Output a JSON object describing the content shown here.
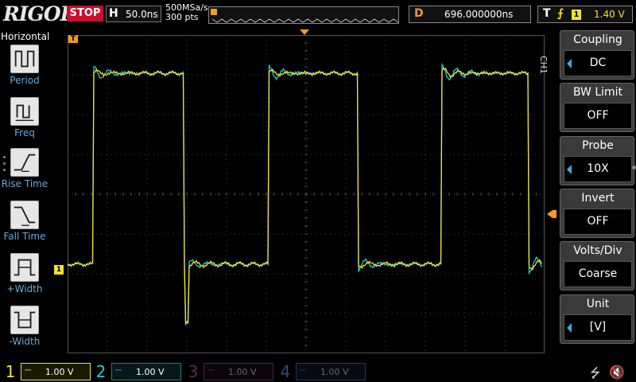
{
  "top": {
    "brand": "RIGOL",
    "run_state": "STOP",
    "timebase_label": "H",
    "timebase_value": "50.0ns",
    "sample_rate": "500MSa/s",
    "memory_depth": "300 pts",
    "delay_label": "D",
    "delay_value": "696.000000ns",
    "trigger_label": "T",
    "trigger_source": "1",
    "trigger_level": "1.40 V"
  },
  "left_menu": {
    "title": "Horizontal",
    "items": [
      {
        "label": "Period",
        "icon": "period-icon"
      },
      {
        "label": "Freq",
        "icon": "freq-icon"
      },
      {
        "label": "Rise Time",
        "icon": "rise-time-icon"
      },
      {
        "label": "Fall Time",
        "icon": "fall-time-icon"
      },
      {
        "label": "+Width",
        "icon": "pos-width-icon"
      },
      {
        "label": "-Width",
        "icon": "neg-width-icon"
      }
    ]
  },
  "right_menu": {
    "channel_tag": "CH1",
    "items": [
      {
        "title": "Coupling",
        "value": "DC",
        "has_arrow": true
      },
      {
        "title": "BW Limit",
        "value": "OFF",
        "has_arrow": false
      },
      {
        "title": "Probe",
        "value": "10X",
        "has_arrow": true
      },
      {
        "title": "Invert",
        "value": "OFF",
        "has_arrow": false
      },
      {
        "title": "Volts/Div",
        "value": "Coarse",
        "has_arrow": false
      },
      {
        "title": "Unit",
        "value": "[V]",
        "has_arrow": true
      }
    ]
  },
  "channels": [
    {
      "num": "1",
      "coupling": "DC",
      "scale": "1.00 V",
      "color": "#f5e12f",
      "active": true
    },
    {
      "num": "2",
      "coupling": "DC",
      "scale": "1.00 V",
      "color": "#24c8d0",
      "active": true
    },
    {
      "num": "3",
      "coupling": "DC",
      "scale": "1.00 V",
      "color": "#c234a8",
      "active": false
    },
    {
      "num": "4",
      "coupling": "DC",
      "scale": "1.00 V",
      "color": "#3a6fd8",
      "active": false
    }
  ],
  "markers": {
    "ch1_marker": "1",
    "trigger_pos_marker": "T"
  },
  "colors": {
    "ch1": "#f5e12f",
    "ch2": "#24c8d0",
    "trigger": "#f39c1f",
    "stop": "#c8102e"
  }
}
